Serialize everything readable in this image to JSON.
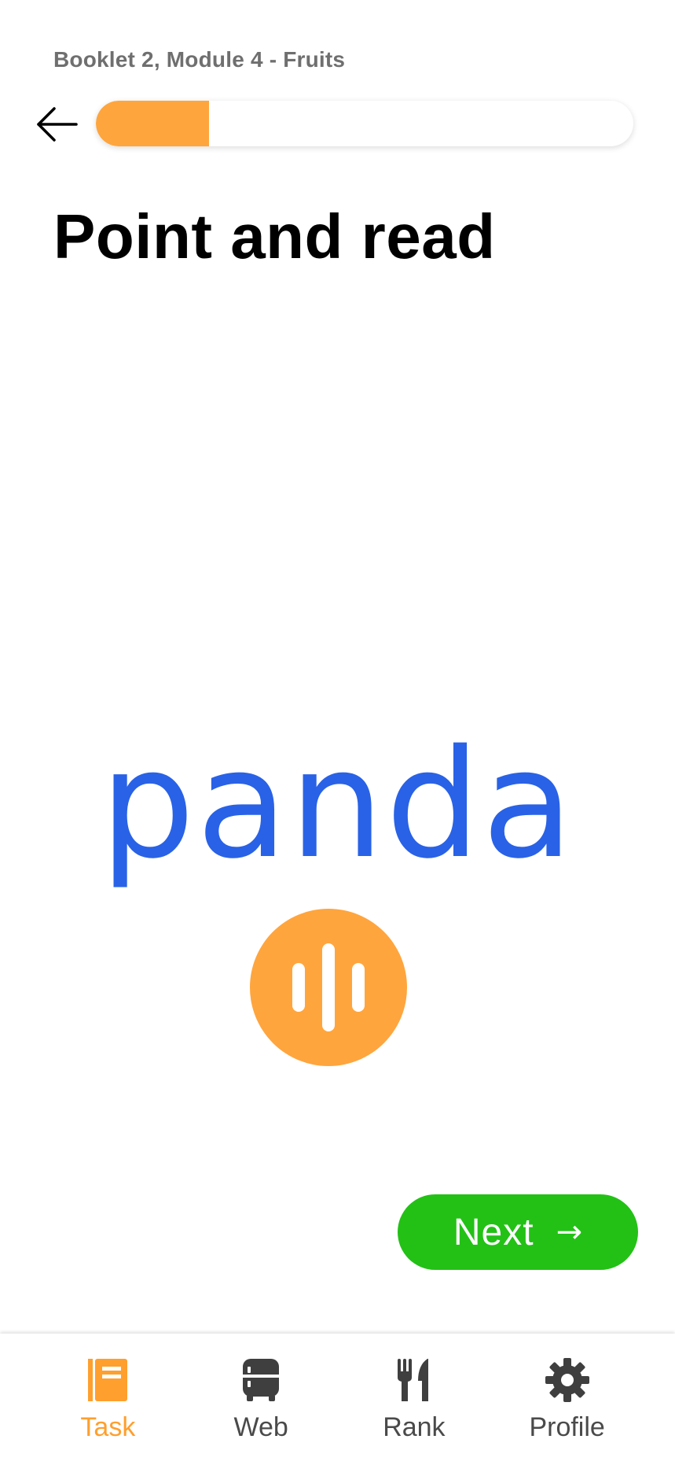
{
  "header": {
    "breadcrumb": "Booklet 2, Module 4 - Fruits",
    "progress_fraction": 0.21,
    "progress_color": "#ffa53d"
  },
  "main": {
    "title": "Point and read",
    "word": "panda",
    "word_color": "#2962e6",
    "audio_icon": "audio-wave-icon",
    "next_label": "Next",
    "next_arrow": "→",
    "next_color": "#23c116"
  },
  "bottom_nav": {
    "active": "Task",
    "active_color": "#ff9f2e",
    "items": [
      {
        "label": "Task",
        "icon": "book-icon"
      },
      {
        "label": "Web",
        "icon": "fridge-icon"
      },
      {
        "label": "Rank",
        "icon": "utensils-icon"
      },
      {
        "label": "Profile",
        "icon": "gear-icon"
      }
    ]
  }
}
